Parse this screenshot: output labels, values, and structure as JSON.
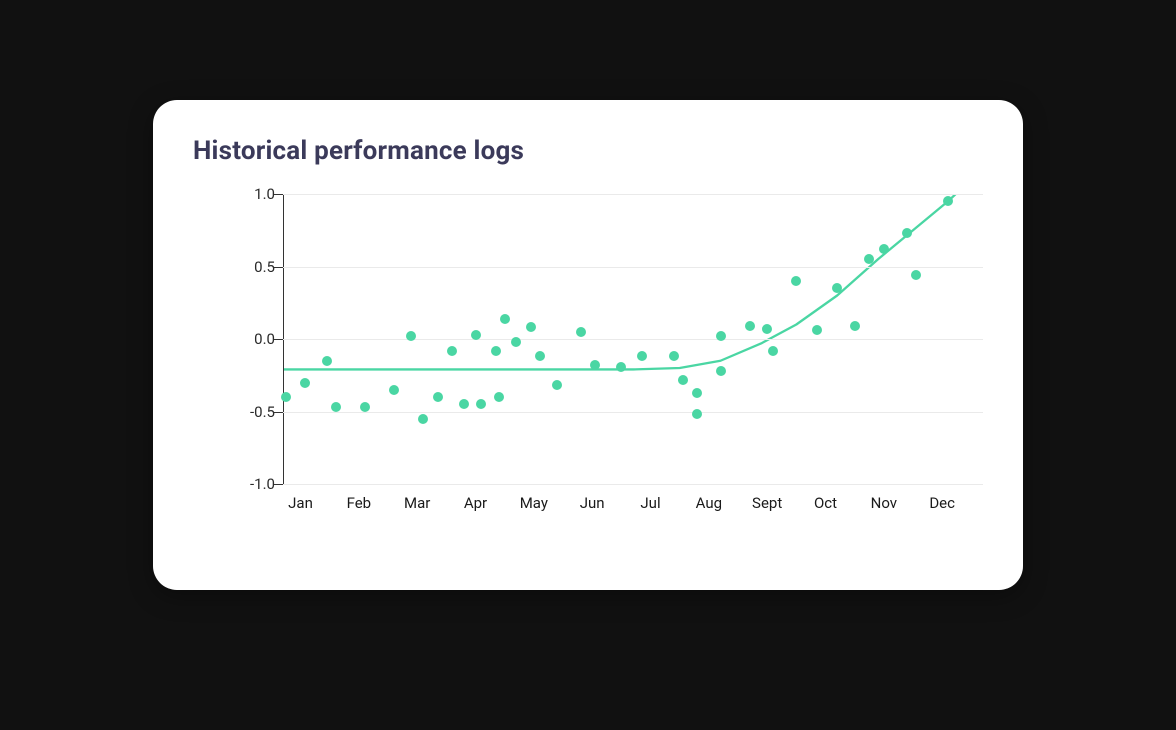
{
  "title": "Historical performance logs",
  "chart_data": {
    "type": "scatter",
    "title": "Historical performance logs",
    "xlabel": "",
    "ylabel": "",
    "ylim": [
      -1.0,
      1.0
    ],
    "xlim": [
      0,
      12
    ],
    "categories": [
      "Jan",
      "Feb",
      "Mar",
      "Apr",
      "May",
      "Jun",
      "Jul",
      "Aug",
      "Sept",
      "Oct",
      "Nov",
      "Dec"
    ],
    "series": [
      {
        "name": "scatter",
        "type": "scatter",
        "color": "#4ad6a3",
        "points": [
          {
            "x": 0.05,
            "y": -0.4
          },
          {
            "x": 0.38,
            "y": -0.3
          },
          {
            "x": 0.75,
            "y": -0.15
          },
          {
            "x": 0.9,
            "y": -0.47
          },
          {
            "x": 1.4,
            "y": -0.47
          },
          {
            "x": 1.9,
            "y": -0.35
          },
          {
            "x": 2.2,
            "y": 0.02
          },
          {
            "x": 2.4,
            "y": -0.55
          },
          {
            "x": 2.65,
            "y": -0.4
          },
          {
            "x": 2.9,
            "y": -0.08
          },
          {
            "x": 3.1,
            "y": -0.45
          },
          {
            "x": 3.3,
            "y": 0.03
          },
          {
            "x": 3.4,
            "y": -0.45
          },
          {
            "x": 3.65,
            "y": -0.08
          },
          {
            "x": 3.7,
            "y": -0.4
          },
          {
            "x": 3.8,
            "y": 0.14
          },
          {
            "x": 4.0,
            "y": -0.02
          },
          {
            "x": 4.25,
            "y": 0.08
          },
          {
            "x": 4.4,
            "y": -0.12
          },
          {
            "x": 4.7,
            "y": -0.32
          },
          {
            "x": 5.1,
            "y": 0.05
          },
          {
            "x": 5.35,
            "y": -0.18
          },
          {
            "x": 5.8,
            "y": -0.19
          },
          {
            "x": 6.15,
            "y": -0.12
          },
          {
            "x": 6.7,
            "y": -0.12
          },
          {
            "x": 6.85,
            "y": -0.28
          },
          {
            "x": 7.1,
            "y": -0.37
          },
          {
            "x": 7.1,
            "y": -0.52
          },
          {
            "x": 7.5,
            "y": 0.02
          },
          {
            "x": 7.5,
            "y": -0.22
          },
          {
            "x": 8.0,
            "y": 0.09
          },
          {
            "x": 8.3,
            "y": 0.07
          },
          {
            "x": 8.4,
            "y": -0.08
          },
          {
            "x": 8.8,
            "y": 0.4
          },
          {
            "x": 9.15,
            "y": 0.06
          },
          {
            "x": 9.5,
            "y": 0.35
          },
          {
            "x": 9.8,
            "y": 0.09
          },
          {
            "x": 10.05,
            "y": 0.55
          },
          {
            "x": 10.3,
            "y": 0.62
          },
          {
            "x": 10.7,
            "y": 0.73
          },
          {
            "x": 10.85,
            "y": 0.44
          },
          {
            "x": 11.4,
            "y": 0.95
          }
        ]
      },
      {
        "name": "trend",
        "type": "line",
        "color": "#4ad6a3",
        "points": [
          {
            "x": 0.0,
            "y": -0.21
          },
          {
            "x": 1.0,
            "y": -0.21
          },
          {
            "x": 2.0,
            "y": -0.21
          },
          {
            "x": 3.0,
            "y": -0.21
          },
          {
            "x": 4.0,
            "y": -0.21
          },
          {
            "x": 5.0,
            "y": -0.21
          },
          {
            "x": 6.0,
            "y": -0.21
          },
          {
            "x": 6.8,
            "y": -0.2
          },
          {
            "x": 7.5,
            "y": -0.15
          },
          {
            "x": 8.2,
            "y": -0.03
          },
          {
            "x": 8.8,
            "y": 0.1
          },
          {
            "x": 9.5,
            "y": 0.3
          },
          {
            "x": 10.2,
            "y": 0.55
          },
          {
            "x": 10.8,
            "y": 0.75
          },
          {
            "x": 11.4,
            "y": 0.95
          },
          {
            "x": 11.8,
            "y": 1.1
          }
        ]
      }
    ],
    "y_ticks": [
      1.0,
      0.5,
      0.0,
      -0.5,
      -1.0
    ]
  }
}
